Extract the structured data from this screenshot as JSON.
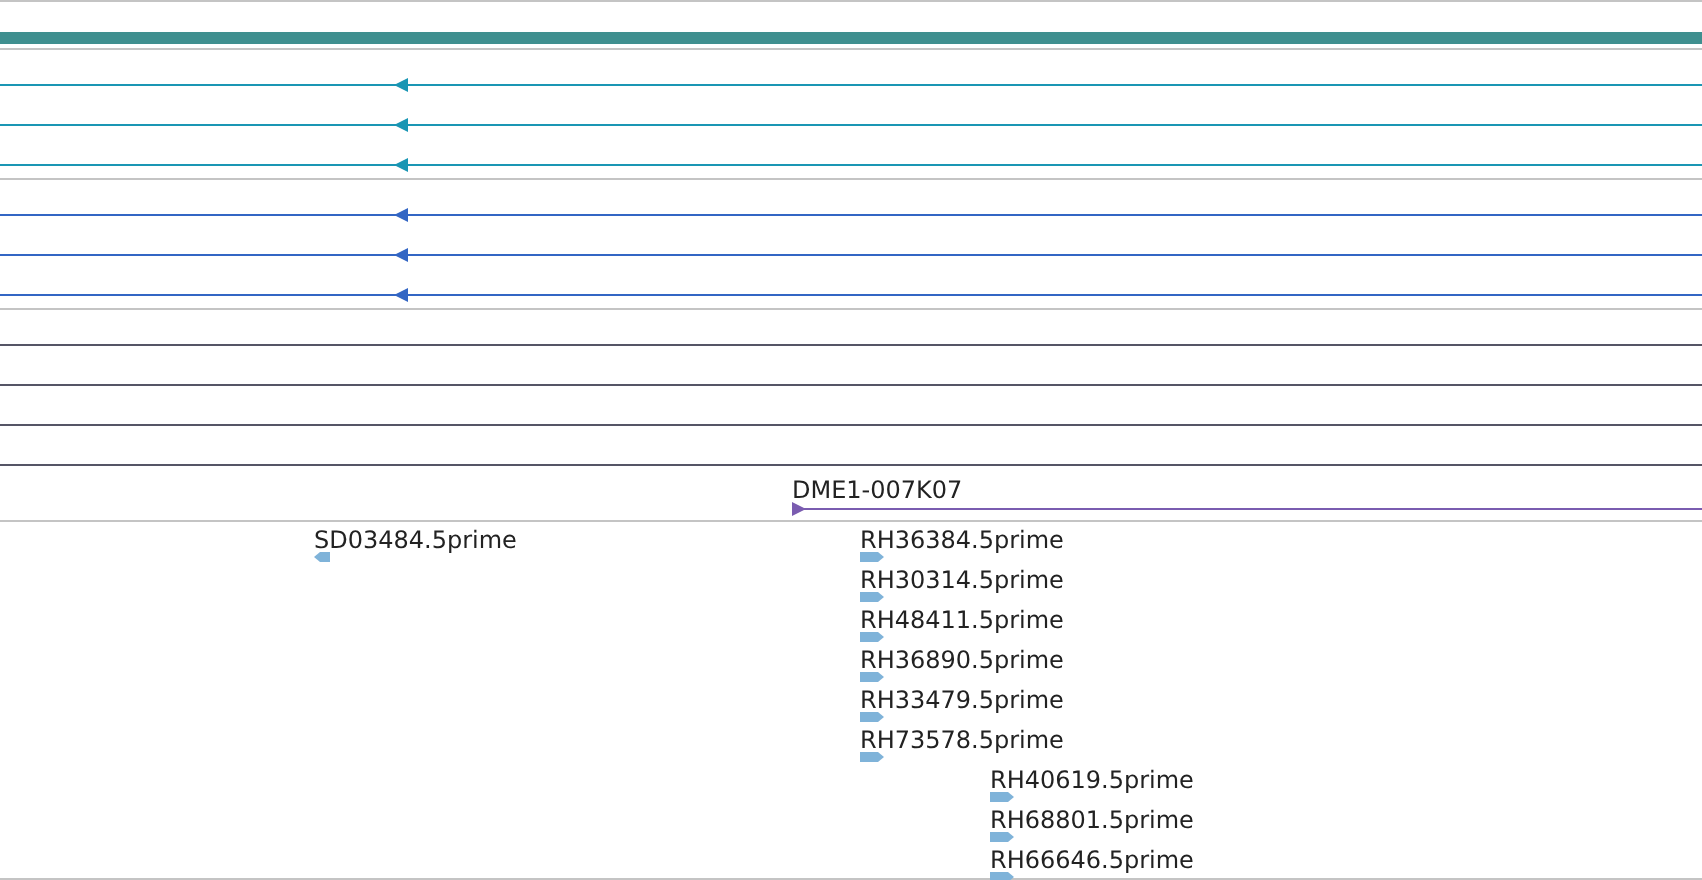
{
  "track_groups": [
    {
      "color": "#1a96b4",
      "rows": [
        {
          "kind": "arrow",
          "reverse": true
        },
        {
          "kind": "arrow",
          "reverse": true
        },
        {
          "kind": "arrow",
          "reverse": true
        }
      ]
    },
    {
      "color": "#3366c4",
      "rows": [
        {
          "kind": "arrow",
          "reverse": true
        },
        {
          "kind": "arrow",
          "reverse": true
        },
        {
          "kind": "arrow",
          "reverse": true
        }
      ]
    },
    {
      "color": "#555566",
      "rows": [
        {
          "kind": "line"
        },
        {
          "kind": "line"
        },
        {
          "kind": "line"
        },
        {
          "kind": "line"
        }
      ]
    }
  ],
  "clone": {
    "label": "DME1-007K07",
    "reverse": false,
    "color": "#7a5cb0"
  },
  "est_stacks": [
    {
      "items": [
        {
          "label": "SD03484.5prime",
          "reverse": true
        }
      ]
    },
    {
      "items": [
        {
          "label": "RH36384.5prime",
          "reverse": false
        },
        {
          "label": "RH30314.5prime",
          "reverse": false
        },
        {
          "label": "RH48411.5prime",
          "reverse": false
        },
        {
          "label": "RH36890.5prime",
          "reverse": false
        },
        {
          "label": "RH33479.5prime",
          "reverse": false
        },
        {
          "label": "RH73578.5prime",
          "reverse": false
        }
      ]
    },
    {
      "items": [
        {
          "label": "RH40619.5prime",
          "reverse": false
        },
        {
          "label": "RH68801.5prime",
          "reverse": false
        },
        {
          "label": "RH66646.5prime",
          "reverse": false
        }
      ]
    }
  ]
}
